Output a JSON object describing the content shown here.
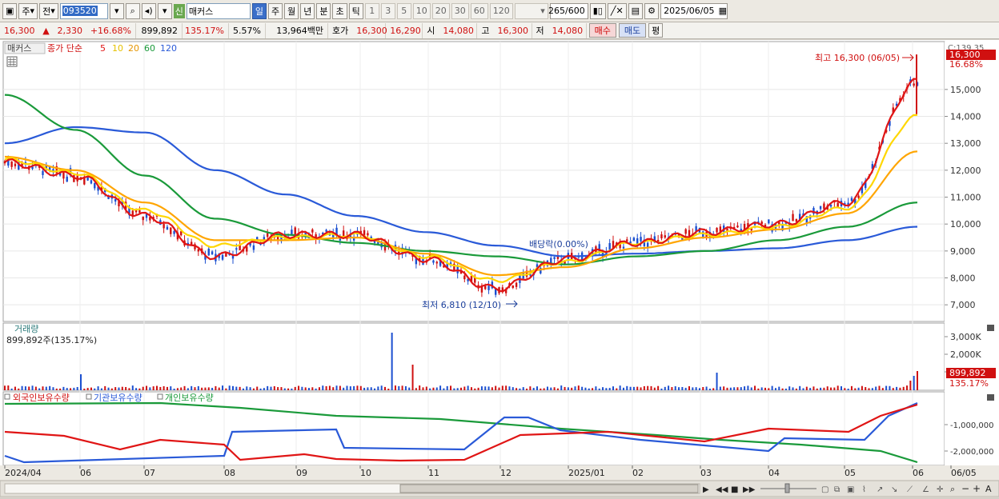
{
  "toolbar": {
    "period_prefix": "주",
    "prev_label": "전",
    "code": "093520",
    "market_badge": "신",
    "stock_name": "매커스",
    "period_tabs": [
      "일",
      "주",
      "월",
      "년",
      "분",
      "초",
      "틱"
    ],
    "active_period": "일",
    "interval_buttons": [
      "1",
      "3",
      "5",
      "10",
      "20",
      "30",
      "60",
      "120"
    ],
    "bar_count": "265",
    "bar_total": "/600",
    "date": "2025/06/05"
  },
  "quote": {
    "price": "16,300",
    "change": "2,330",
    "change_pct": "+16.68%",
    "volume": "899,892",
    "volume_ratio": "135.17%",
    "turnover": "5.57%",
    "trade_value": "13,964백만",
    "ask_label": "호가",
    "ask": "16,300",
    "bid": "16,290",
    "open_label": "시",
    "open": "14,080",
    "high_label": "고",
    "high": "16,300",
    "low_label": "저",
    "low": "14,080",
    "buy_label": "매수",
    "sell_label": "매도",
    "eval_label": "평"
  },
  "chart": {
    "stock_label": "매커스",
    "indicator_label": "종가 단순",
    "ma_periods": [
      "5",
      "10",
      "20",
      "60",
      "120"
    ],
    "ma_colors": [
      "#e01515",
      "#ffd700",
      "#ffa500",
      "#1a9a3a",
      "#2a5ad8"
    ],
    "corner_value": "C:139.35",
    "price_box": "16,300",
    "price_box_pct": "16.68%",
    "high_annot": "최고 16,300 (06/05)",
    "low_annot": "최저 6,810 (12/10)",
    "dividend_annot": "배당락(0.00%)",
    "price_ticks": [
      "15,000",
      "14,000",
      "13,000",
      "12,000",
      "11,000",
      "10,000",
      "9,000",
      "8,000",
      "7,000"
    ],
    "volume_title": "거래량",
    "volume_value": "899,892주(135.17%)",
    "volume_ticks": [
      "3,000K",
      "2,000K",
      "1,000K"
    ],
    "volume_box": "899,892",
    "volume_box_pct": "135.17%",
    "holding_labels": [
      "외국인보유수량",
      "기관보유수량",
      "개인보유수량"
    ],
    "holding_colors": [
      "#e01515",
      "#2a5ad8",
      "#1a9a3a"
    ],
    "holding_ticks": [
      "-1,000,000",
      "-2,000,000"
    ],
    "x_labels": [
      "2024/04",
      "06",
      "07",
      "08",
      "09",
      "10",
      "11",
      "12",
      "2025/01",
      "02",
      "03",
      "04",
      "05",
      "06",
      "06/05"
    ]
  },
  "chart_data": {
    "type": "line",
    "title": "",
    "x": [
      "2024/04",
      "2024/06",
      "2024/07",
      "2024/08",
      "2024/09",
      "2024/10",
      "2024/11",
      "2024/12",
      "2025/01",
      "2025/02",
      "2025/03",
      "2025/04",
      "2025/05",
      "2025/06"
    ],
    "series": [
      {
        "name": "5",
        "values": [
          12300,
          11800,
          10300,
          8800,
          9600,
          9600,
          8700,
          7600,
          8700,
          9300,
          9700,
          10000,
          10800,
          15300
        ]
      },
      {
        "name": "10",
        "values": [
          12400,
          11900,
          10500,
          9200,
          9500,
          9600,
          8800,
          7900,
          8600,
          9300,
          9600,
          9900,
          10600,
          14000
        ]
      },
      {
        "name": "20",
        "values": [
          12500,
          12000,
          10800,
          9400,
          9400,
          9500,
          8900,
          8100,
          8400,
          9100,
          9500,
          9800,
          10400,
          12700
        ]
      },
      {
        "name": "60",
        "values": [
          14800,
          13500,
          11800,
          10200,
          9600,
          9300,
          9000,
          8800,
          8500,
          8800,
          9000,
          9400,
          9900,
          10800
        ]
      },
      {
        "name": "120",
        "values": [
          13000,
          13600,
          13400,
          12000,
          11100,
          10300,
          9700,
          9200,
          8800,
          8900,
          9000,
          9100,
          9400,
          9900
        ]
      }
    ],
    "ylim": [
      6500,
      16600
    ],
    "annotations": [
      "최고 16,300 (06/05)",
      "최저 6,810 (12/10)"
    ]
  }
}
